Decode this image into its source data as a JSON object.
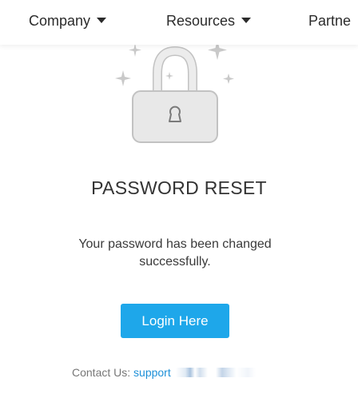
{
  "nav": {
    "items": [
      {
        "label": "Company"
      },
      {
        "label": "Resources"
      },
      {
        "label": "Partne"
      }
    ]
  },
  "icons": {
    "lock": "padlock-icon",
    "sparkles": "sparkle-icon",
    "caret": "chevron-down-icon"
  },
  "main": {
    "title": "PASSWORD RESET",
    "message": "Your password has been changed successfully.",
    "login_button": "Login Here"
  },
  "contact": {
    "label": "Contact Us:",
    "link_text": "support"
  },
  "colors": {
    "accent": "#1ea7ea",
    "link": "#1e90d8",
    "lock_fill": "#e8e8e8",
    "lock_stroke": "#c2c2c2"
  }
}
